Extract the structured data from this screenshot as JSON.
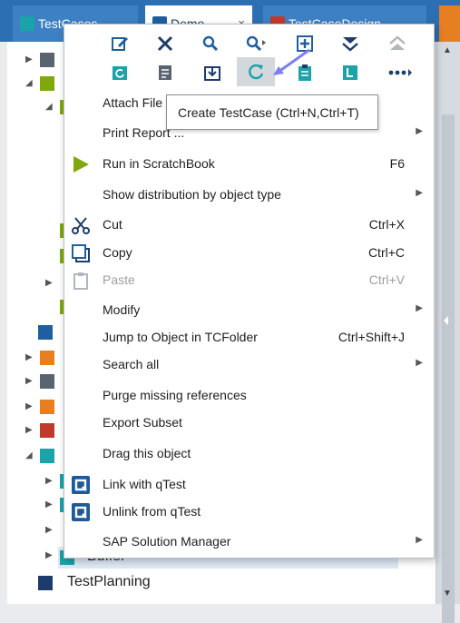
{
  "tabs": [
    {
      "label": "TestCases"
    },
    {
      "label": "Demo"
    },
    {
      "label": "TestCaseDesign"
    }
  ],
  "tab_close_glyph": "×",
  "tree": {
    "partial_row_label": "Buffer",
    "bottom_row_label": "TestPlanning"
  },
  "toolbar": {
    "row1": [
      "edit-icon",
      "delete-icon",
      "search-icon",
      "search-advanced-icon",
      "add-icon",
      "collapse-all-icon",
      "expand-all-icon"
    ],
    "row2": [
      "refresh-folder-icon",
      "details-icon",
      "import-icon",
      "create-testcase-icon",
      "clipboard-icon",
      "library-icon",
      "more-icon"
    ]
  },
  "tooltip": "Create TestCase (Ctrl+N,Ctrl+T)",
  "menu": {
    "attach_file": "Attach File",
    "print_report": "Print Report ...",
    "run_scratchbook": "Run in ScratchBook",
    "run_scratchbook_sc": "F6",
    "show_distribution": "Show distribution by object type",
    "cut": "Cut",
    "cut_sc": "Ctrl+X",
    "copy": "Copy",
    "copy_sc": "Ctrl+C",
    "paste": "Paste",
    "paste_sc": "Ctrl+V",
    "modify": "Modify",
    "jump": "Jump to Object in TCFolder",
    "jump_sc": "Ctrl+Shift+J",
    "search_all": "Search all",
    "purge": "Purge missing references",
    "export_subset": "Export Subset",
    "drag": "Drag this object",
    "link_qtest": "Link with qTest",
    "unlink_qtest": "Unlink from qTest",
    "sap": "SAP Solution Manager"
  },
  "colors": {
    "tab_bar": "#2c6fb3",
    "icon_blue": "#1f5fa0",
    "icon_teal": "#1aa3a8",
    "run_green": "#7fa80d",
    "selection": "#dde9f5"
  }
}
